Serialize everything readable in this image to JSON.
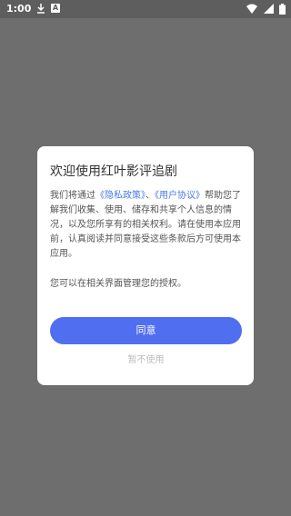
{
  "status_bar": {
    "time": "1:00",
    "icon_a": "A"
  },
  "dialog": {
    "title": "欢迎使用红叶影评追剧",
    "body_prefix": "我们将通过",
    "privacy_link": "《隐私政策》",
    "separator": "、",
    "terms_link": "《用户协议》",
    "body_suffix": "帮助您了解我们收集、使用、储存和共享个人信息的情况，以及您所享有的相关权利。请在使用本应用前，认真阅读并同意接受这些条款后方可使用本应用。",
    "manage_text": "您可以在相关界面管理您的授权。",
    "agree_label": "同意",
    "decline_label": "暂不使用"
  },
  "colors": {
    "accent": "#4f6ff0",
    "link": "#4a79e8",
    "overlay": "#6e6e6e"
  }
}
